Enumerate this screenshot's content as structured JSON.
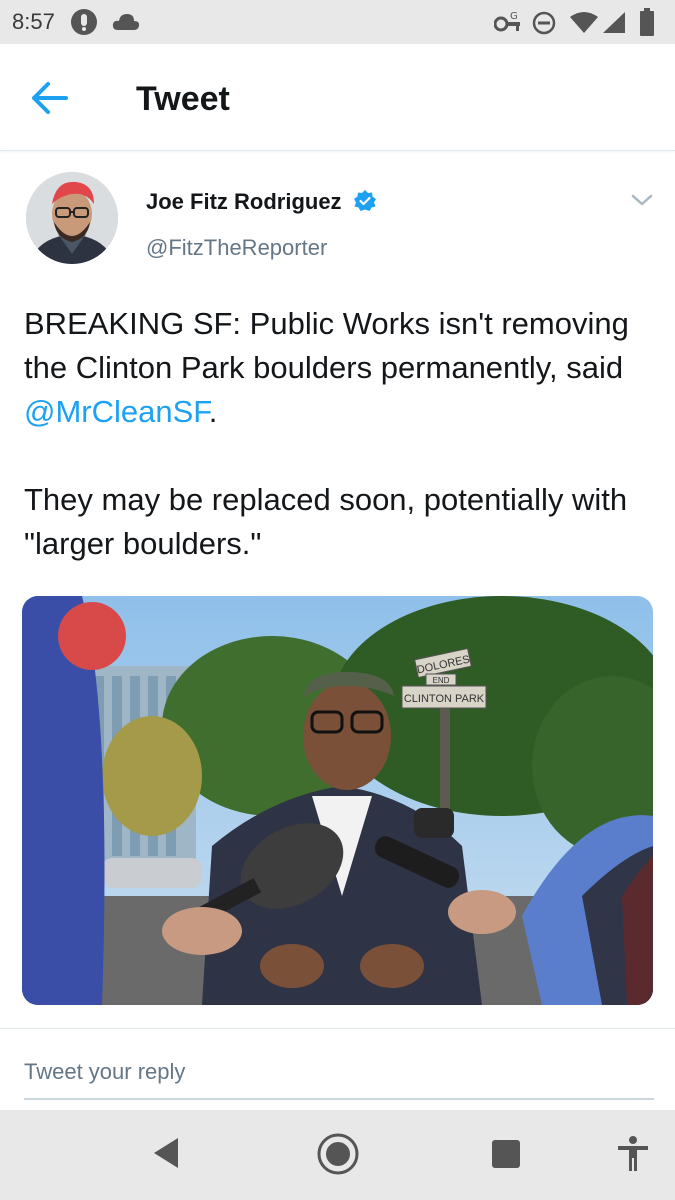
{
  "status_bar": {
    "time": "8:57",
    "icons_left": [
      "notification-icon",
      "cloud-icon"
    ],
    "icons_right": [
      "vpn-key-icon",
      "do-not-disturb-icon",
      "wifi-icon",
      "signal-icon",
      "battery-icon"
    ]
  },
  "header": {
    "title": "Tweet",
    "back_icon": "arrow-left-icon"
  },
  "tweet": {
    "author_name": "Joe Fitz Rodriguez",
    "handle": "@FitzTheReporter",
    "verified": true,
    "text_line1": "BREAKING SF: Public Works isn't removing the Clinton Park boulders permanently, said ",
    "mention": "@MrCleanSF",
    "text_line1_end": ".",
    "text_para2": "They may be replaced soon, potentially with \"larger boulders.\"",
    "photo": {
      "sign_top": "DOLORES",
      "sign_end": "END",
      "sign_bottom": "CLINTON PARK"
    }
  },
  "reply": {
    "placeholder": "Tweet your reply"
  },
  "nav": {
    "icons": [
      "back-triangle-icon",
      "home-circle-icon",
      "recents-square-icon",
      "accessibility-icon"
    ]
  },
  "colors": {
    "accent": "#1da1f2",
    "text": "#14171a",
    "secondary": "#657786",
    "bars": "#e8e8e8"
  }
}
